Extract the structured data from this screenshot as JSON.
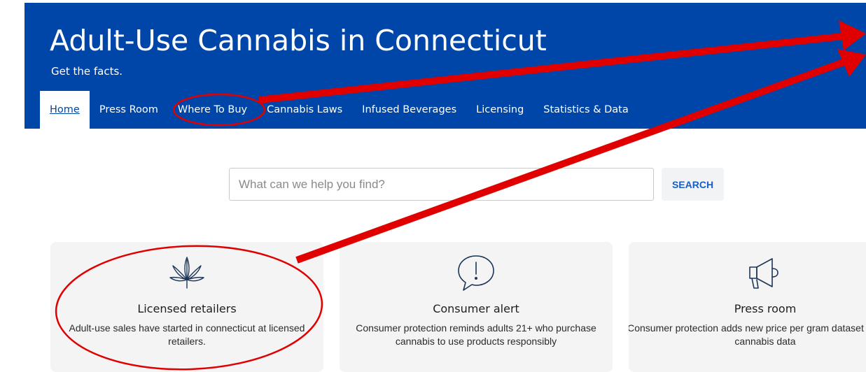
{
  "header": {
    "title": "Adult-Use Cannabis in Connecticut",
    "tagline": "Get the facts."
  },
  "nav": {
    "items": [
      {
        "label": "Home",
        "active": true
      },
      {
        "label": "Press Room",
        "active": false
      },
      {
        "label": "Where To Buy",
        "active": false
      },
      {
        "label": "Cannabis Laws",
        "active": false
      },
      {
        "label": "Infused Beverages",
        "active": false
      },
      {
        "label": "Licensing",
        "active": false
      },
      {
        "label": "Statistics & Data",
        "active": false
      }
    ]
  },
  "search": {
    "placeholder": "What can we help you find?",
    "value": "",
    "button_label": "SEARCH"
  },
  "cards": [
    {
      "icon": "cannabis-leaf-icon",
      "title": "Licensed retailers",
      "description": "Adult-use sales have started in connecticut at licensed retailers."
    },
    {
      "icon": "exclamation-speech-bubble-icon",
      "title": "Consumer alert",
      "description": "Consumer protection reminds adults 21+ who purchase cannabis to use products responsibly"
    },
    {
      "icon": "megaphone-icon",
      "title": "Press room",
      "description": "Consumer protection adds new price per gram dataset to public cannabis data"
    }
  ],
  "colors": {
    "header_bg": "#0046a8",
    "annotation_red": "#e00000",
    "card_bg": "#f4f4f4",
    "search_button_text": "#1a5dc4"
  }
}
